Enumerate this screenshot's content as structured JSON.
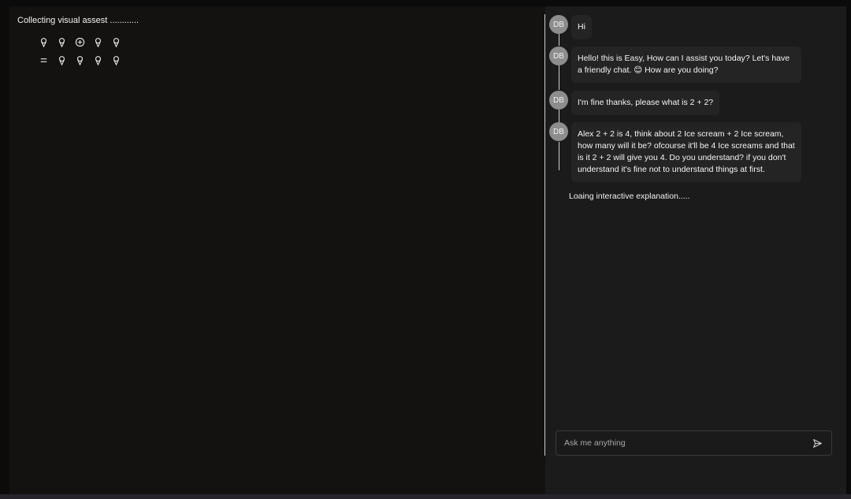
{
  "left_panel": {
    "status_text": "Collecting visual assest ............",
    "row1": [
      "ice-cream-icon",
      "ice-cream-icon",
      "plus-circle-icon",
      "ice-cream-icon",
      "ice-cream-icon"
    ],
    "row2": [
      "equals-icon",
      "ice-cream-icon",
      "ice-cream-icon",
      "ice-cream-icon",
      "ice-cream-icon"
    ]
  },
  "chat": {
    "messages": [
      {
        "avatar": "DB",
        "text": "Hi"
      },
      {
        "avatar": "DB",
        "text": "Hello! this is Easy, How can I assist you today? Let's have a friendly chat. 😊 How are you doing?"
      },
      {
        "avatar": "DB",
        "text": "I'm fine thanks, please what is 2 + 2?"
      },
      {
        "avatar": "DB",
        "text": "Alex 2 + 2 is 4, think about 2 Ice scream + 2 Ice scream, how many will it be? ofcourse it'll be 4 Ice screams and that is it 2 + 2 will give you 4. Do you understand? if you don't understand it's fine not to understand things at first."
      }
    ],
    "loading_text": "Loaing interactive explanation.....",
    "composer": {
      "placeholder": "Ask me anything",
      "value": ""
    },
    "colors": {
      "panel": "#1b1b1b",
      "bubble": "#242424",
      "avatar": "#8d8d8d"
    }
  }
}
